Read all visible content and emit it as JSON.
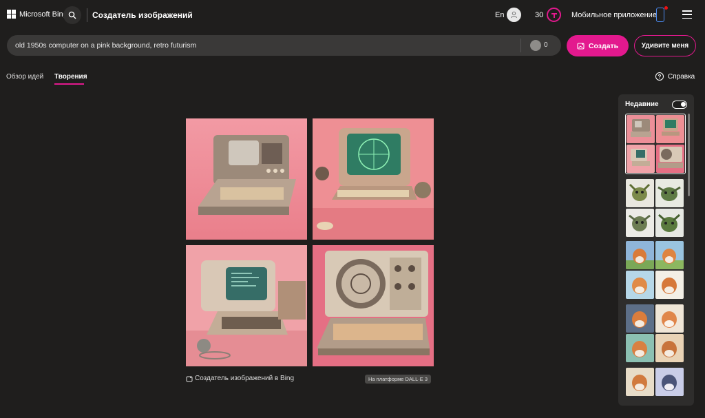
{
  "header": {
    "brand": "Microsoft Bing",
    "app_title": "Создатель изображений",
    "lang": "En",
    "coins": "30",
    "mobile_app": "Мобильное приложение",
    "icons": {
      "search": "search-icon",
      "avatar": "user-avatar-icon",
      "coin": "rewards-coin-icon",
      "phone": "phone-icon",
      "menu": "hamburger-menu-icon"
    }
  },
  "prompt": {
    "value": "old 1950s computer on a pink background, retro futurism",
    "boosts": "0"
  },
  "buttons": {
    "create": "Создать",
    "surprise": "Удивите меня"
  },
  "tabs": {
    "explore": "Обзор идей",
    "creations": "Творения",
    "help": "Справка",
    "help_glyph": "?"
  },
  "result": {
    "caption": "Создатель изображений в Bing",
    "badge": "На платформе DALL·E 3"
  },
  "recent": {
    "title": "Недавние",
    "toggle_on": true
  },
  "colors": {
    "accent": "#e3198e",
    "background": "#1f1e1d",
    "panel": "#2e2d2c"
  }
}
